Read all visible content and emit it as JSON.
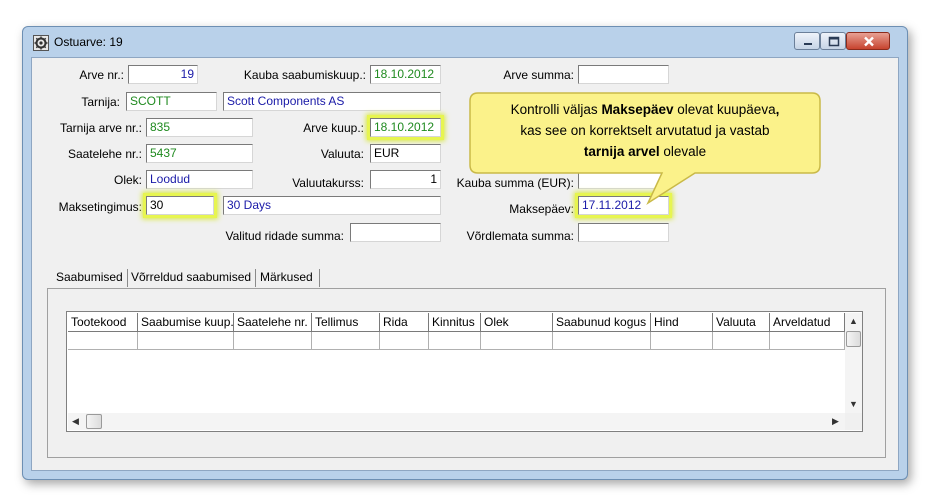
{
  "window": {
    "title": "Ostuarve: 19"
  },
  "form": {
    "arve_nr": {
      "label": "Arve nr.:",
      "value": "19"
    },
    "kauba_saabumiskuup": {
      "label": "Kauba saabumiskuup.:",
      "value": "18.10.2012"
    },
    "arve_summa": {
      "label": "Arve summa:",
      "value": ""
    },
    "tarnija": {
      "label": "Tarnija:",
      "code": "SCOTT",
      "name": "Scott Components AS"
    },
    "tarnija_arve_nr": {
      "label": "Tarnija arve nr.:",
      "value": "835"
    },
    "arve_kuup": {
      "label": "Arve kuup.:",
      "value": "18.10.2012"
    },
    "saatelehe_nr": {
      "label": "Saatelehe nr.:",
      "value": "5437"
    },
    "valuuta": {
      "label": "Valuuta:",
      "value": "EUR"
    },
    "olek": {
      "label": "Olek:",
      "value": "Loodud"
    },
    "valuutakurss": {
      "label": "Valuutakurss:",
      "value": "1"
    },
    "kauba_summa": {
      "label": "Kauba summa (EUR):",
      "value": ""
    },
    "maksetingimus": {
      "label": "Maksetingimus:",
      "code": "30",
      "name": "30 Days"
    },
    "maksepaev": {
      "label": "Maksepäev:",
      "value": "17.11.2012"
    },
    "valitud_ridade_summa": {
      "label": "Valitud ridade summa:",
      "value": ""
    },
    "vordlemata_summa": {
      "label": "Võrdlemata summa:",
      "value": ""
    }
  },
  "callout": {
    "line1_prefix": "Kontrolli väljas ",
    "line1_bold": "Maksepäev",
    "line1_suffix": " olevat kuupäeva",
    "line1_comma": ",",
    "line2": "kas see on korrektselt arvutatud ja vastab",
    "line3_bold": "tarnija arvel",
    "line3_suffix": " olevale"
  },
  "tabs": [
    {
      "label": "Saabumised"
    },
    {
      "label": "Võrreldud saabumised"
    },
    {
      "label": "Märkused"
    }
  ],
  "table": {
    "columns": [
      "Tootekood",
      "Saabumise kuup.",
      "Saatelehe nr.",
      "Tellimus",
      "Rida",
      "Kinnitus",
      "Olek",
      "Saabunud kogus",
      "Hind",
      "Valuuta",
      "Arveldatud"
    ]
  },
  "colors": {
    "highlight": "#e7f550",
    "callout_fill": "#fbf28a",
    "green_text": "#1f8a1f",
    "blue_text": "#1a1aa8"
  },
  "icons": [
    "app-settings-icon",
    "minimize-icon",
    "maximize-icon",
    "close-icon",
    "scroll-up-icon",
    "scroll-down-icon",
    "scroll-left-icon",
    "scroll-right-icon"
  ]
}
